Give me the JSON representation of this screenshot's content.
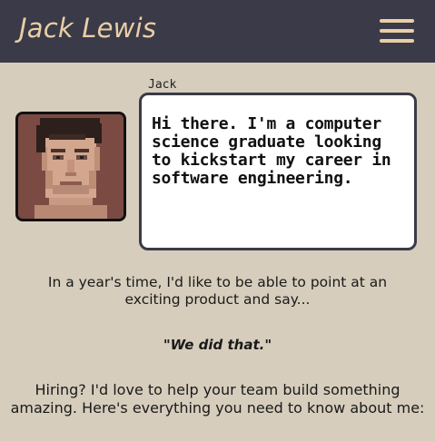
{
  "header": {
    "title": "Jack Lewis",
    "menu_icon": "hamburger-menu-icon",
    "background": "#3b3a48",
    "accent": "#e9cfa6"
  },
  "dialogue": {
    "speaker": "Jack",
    "avatar_icon": "pixel-art-portrait",
    "message": "Hi there. I'm a computer science graduate looking to kickstart my career in software engineering."
  },
  "content": {
    "intro": "In a year's time, I'd like to be able to point at an exciting product and say...",
    "quote": "\"We did that.\"",
    "hiring": "Hiring? I'd love to help your team build something amazing. Here's everything you need to know about me:"
  },
  "colors": {
    "page_background": "#d6cdbc",
    "bubble_border": "#3b3a48"
  }
}
